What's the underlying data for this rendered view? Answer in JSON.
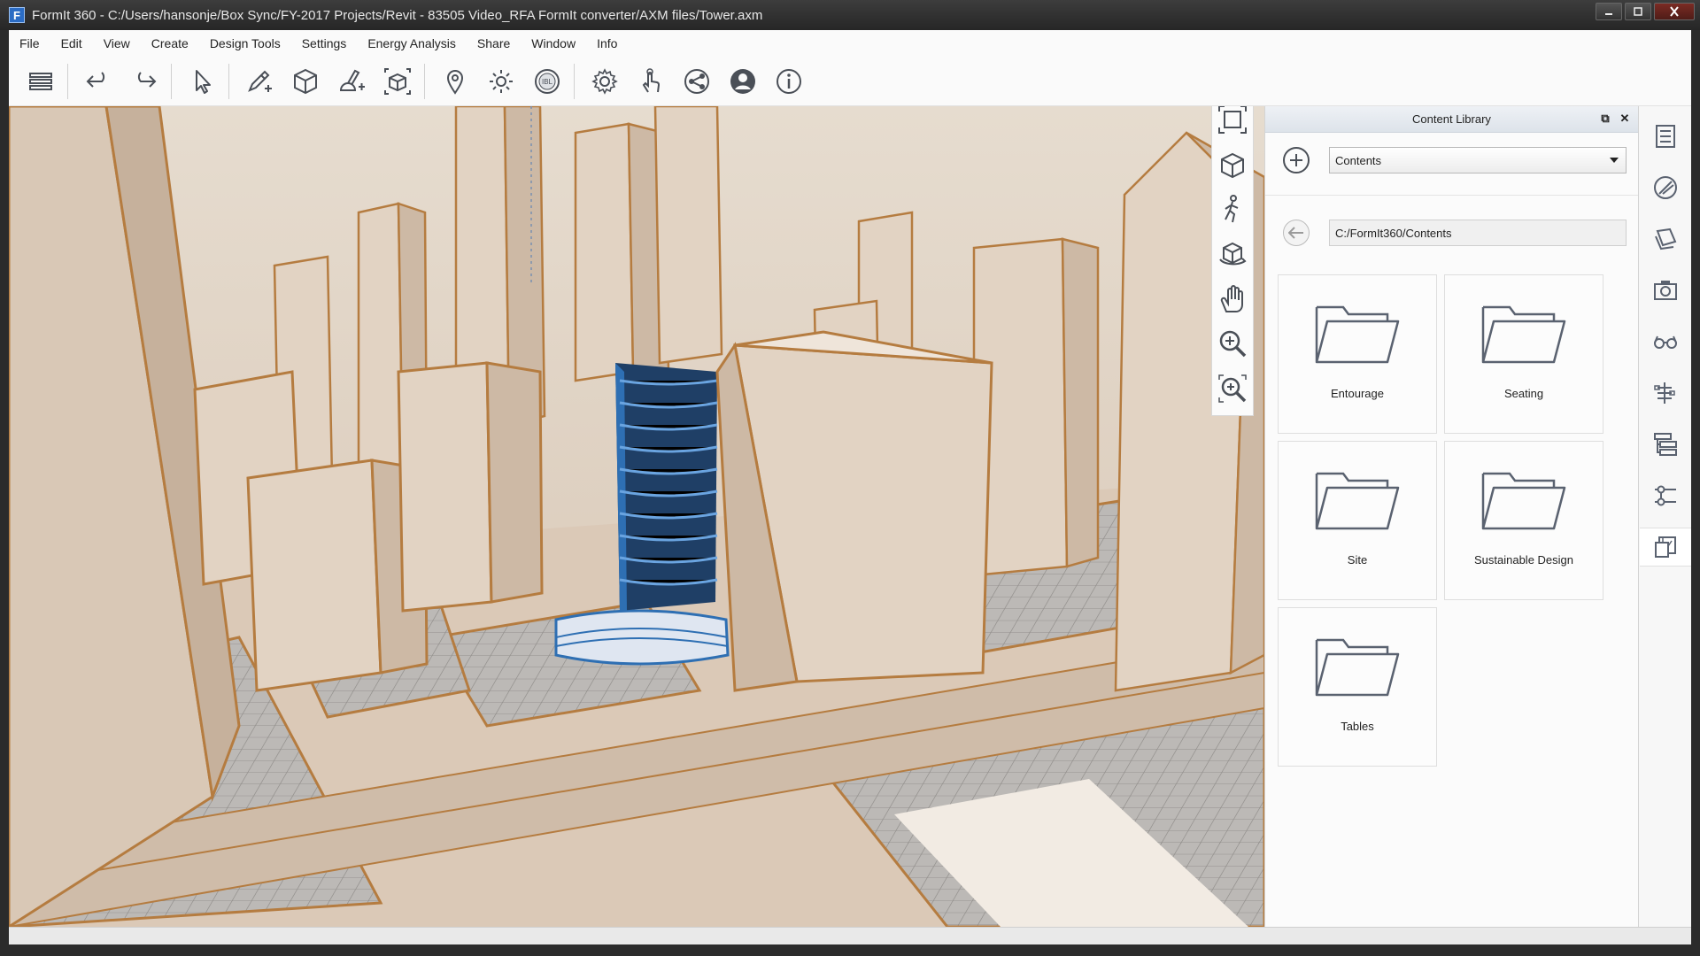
{
  "window": {
    "title": "FormIt 360 - C:/Users/hansonje/Box Sync/FY-2017 Projects/Revit - 83505 Video_RFA FormIt converter/AXM files/Tower.axm",
    "app_icon_letter": "F",
    "controls": [
      "minimize-icon",
      "maximize-icon",
      "close-icon"
    ]
  },
  "menu": [
    "File",
    "Edit",
    "View",
    "Create",
    "Design Tools",
    "Settings",
    "Energy Analysis",
    "Share",
    "Window",
    "Info"
  ],
  "toolbar": {
    "icons": [
      "layers-menu-icon",
      "undo-icon",
      "redo-icon",
      "select-arrow-icon",
      "sketch-pencil-icon",
      "solid-cube-icon",
      "solid-tools-icon",
      "groups-icon",
      "location-pin-icon",
      "sun-icon",
      "ibl-icon",
      "settings-gear-icon",
      "touch-gesture-icon",
      "share-icon",
      "user-account-icon",
      "info-icon"
    ],
    "ibl_label": "IBL"
  },
  "nav_icons": [
    "zoom-extents-icon",
    "view-cube-icon",
    "walk-icon",
    "orbit-icon",
    "pan-hand-icon",
    "zoom-icon",
    "zoom-window-icon"
  ],
  "content_library": {
    "title": "Content Library",
    "source_value": "Contents",
    "path": "C:/FormIt360/Contents",
    "folders": [
      "Entourage",
      "Seating",
      "Site",
      "Sustainable Design",
      "Tables"
    ]
  },
  "right_strip": [
    "properties-icon",
    "materials-brush-icon",
    "layers-icon",
    "scenes-camera-icon",
    "view-glasses-icon",
    "levels-icon",
    "groups-hierarchy-icon",
    "sliders-icon",
    "content-library-icon"
  ],
  "colors": {
    "building_fill": "#e2d3c3",
    "building_edge": "#b57c40",
    "tower_blue": "#2e6fb3",
    "ground_grid": "#a9a6a3"
  }
}
